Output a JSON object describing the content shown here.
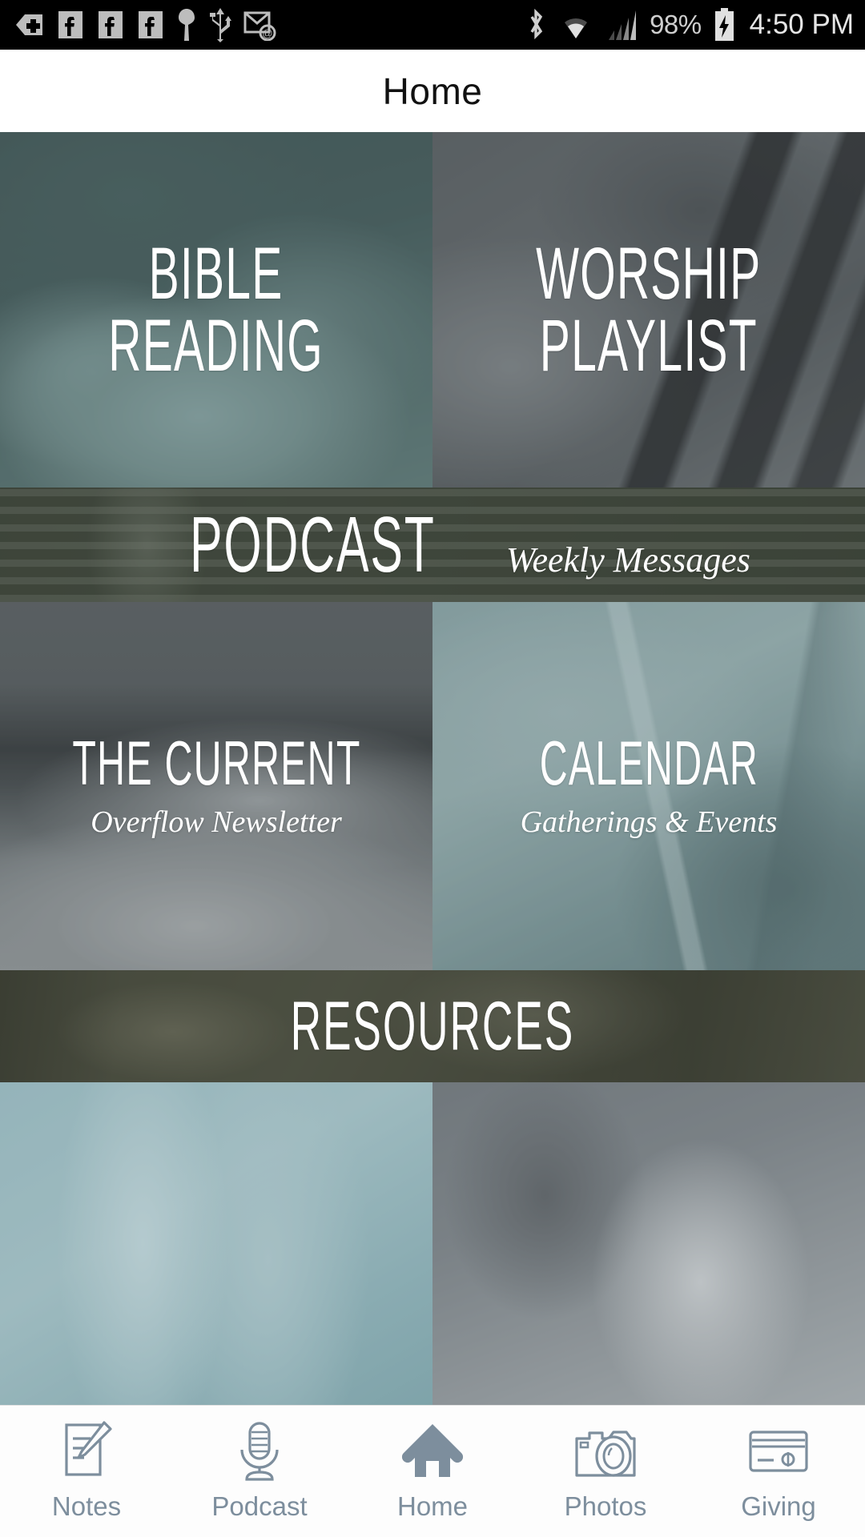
{
  "statusbar": {
    "left_icons": [
      "back-plus-icon",
      "facebook-icon",
      "facebook-icon",
      "facebook-icon",
      "key-icon",
      "usb-icon",
      "email-icon"
    ],
    "right_icons": [
      "bluetooth-icon",
      "wifi-icon",
      "cell-signal-icon",
      "battery-charging-icon"
    ],
    "battery_percent": "98%",
    "time": "4:50 PM"
  },
  "header": {
    "title": "Home"
  },
  "colors": {
    "accent": "#7d8e9d",
    "teal_tint": "#6d8a8e",
    "gray_tint": "#6e7477",
    "olive_tint": "#3f463c",
    "nav_text": "#7d8e9d",
    "status_bg": "#000000",
    "title_text": "#111111"
  },
  "tiles": [
    {
      "name": "bible-reading",
      "title_line1": "BIBLE",
      "title_line2": "READING",
      "subtitle": "",
      "tint": "rgba(97,129,134,0.72)",
      "image": "hands-holding-open-bible"
    },
    {
      "name": "worship-playlist",
      "title_line1": "WORSHIP",
      "title_line2": "PLAYLIST",
      "subtitle": "",
      "tint": "rgba(104,110,113,0.66)",
      "image": "hands-playing-piano-keys"
    },
    {
      "name": "podcast",
      "title_line1": "PODCAST",
      "title_line2": "",
      "subtitle": "Weekly Messages",
      "tint": "rgba(60,68,58,0.82)",
      "image": "vintage-microphone"
    },
    {
      "name": "the-current",
      "title_line1": "THE CURRENT",
      "title_line2": "",
      "subtitle": "Overflow Newsletter",
      "tint": "rgba(110,116,119,0.60)",
      "image": "snowy-mountain-landscape"
    },
    {
      "name": "calendar",
      "title_line1": "CALENDAR",
      "title_line2": "",
      "subtitle": "Gatherings & Events",
      "tint": "rgba(122,151,154,0.62)",
      "image": "open-planner-calendar"
    },
    {
      "name": "resources",
      "title_line1": "RESOURCES",
      "title_line2": "",
      "subtitle": "",
      "tint": "rgba(66,69,57,0.78)",
      "image": "workbench-tools"
    },
    {
      "name": "partial-left",
      "title_line1": "",
      "title_line2": "",
      "subtitle": "",
      "tint": "rgba(128,165,172,0.55)",
      "image": "teal-glass-water"
    },
    {
      "name": "partial-right",
      "title_line1": "",
      "title_line2": "",
      "subtitle": "",
      "tint": "rgba(118,126,131,0.55)",
      "image": "hand-holding-phone"
    }
  ],
  "bottom_nav": {
    "items": [
      {
        "label": "Notes",
        "icon": "notepad-pencil-icon",
        "active": false
      },
      {
        "label": "Podcast",
        "icon": "microphone-icon",
        "active": false
      },
      {
        "label": "Home",
        "icon": "house-icon",
        "active": true
      },
      {
        "label": "Photos",
        "icon": "camera-icon",
        "active": false
      },
      {
        "label": "Giving",
        "icon": "credit-card-icon",
        "active": false
      }
    ]
  }
}
